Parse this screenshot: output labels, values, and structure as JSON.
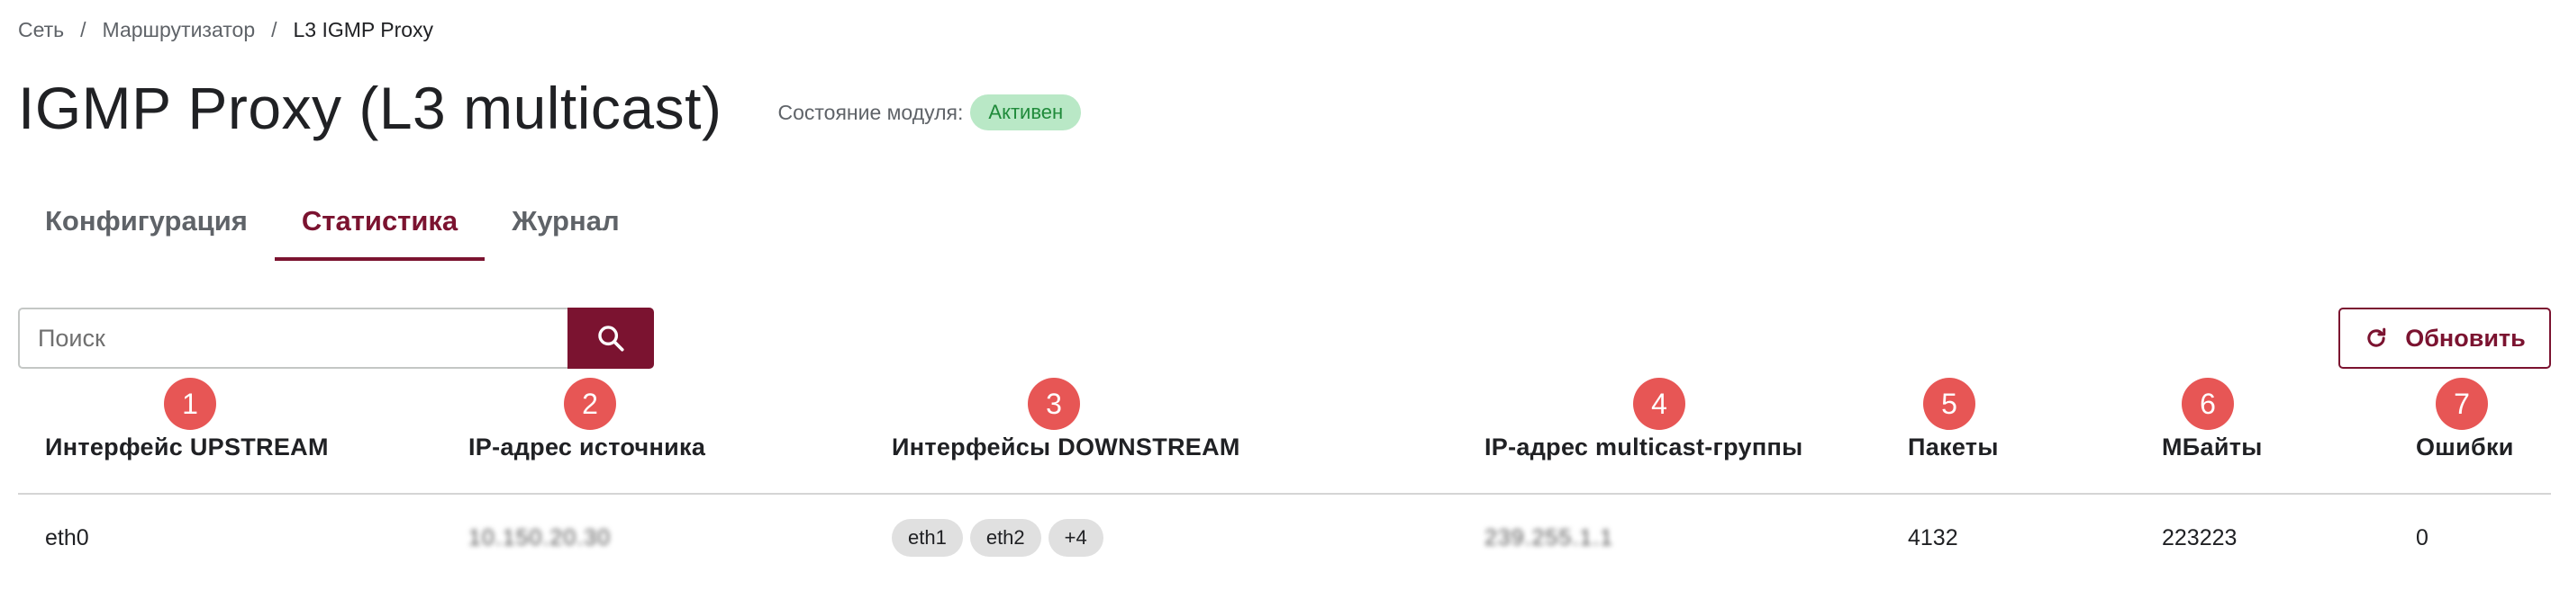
{
  "breadcrumb": {
    "items": [
      "Сеть",
      "Маршрутизатор",
      "L3 IGMP Proxy"
    ],
    "separator": "/"
  },
  "page": {
    "title": "IGMP Proxy (L3 multicast)",
    "module_state_label": "Состояние модуля:",
    "module_state_value": "Активен"
  },
  "tabs": [
    {
      "label": "Конфигурация",
      "active": false
    },
    {
      "label": "Статистика",
      "active": true
    },
    {
      "label": "Журнал",
      "active": false
    }
  ],
  "search": {
    "placeholder": "Поиск",
    "value": "",
    "icon": "search-icon"
  },
  "refresh": {
    "label": "Обновить",
    "icon": "refresh-icon"
  },
  "table": {
    "columns": [
      {
        "marker": "1",
        "label": "Интерфейс UPSTREAM"
      },
      {
        "marker": "2",
        "label": "IP-адрес источника"
      },
      {
        "marker": "3",
        "label": "Интерфейсы DOWNSTREAM"
      },
      {
        "marker": "4",
        "label": "IP-адрес multicast-группы"
      },
      {
        "marker": "5",
        "label": "Пакеты"
      },
      {
        "marker": "6",
        "label": "МБайты"
      },
      {
        "marker": "7",
        "label": "Ошибки"
      }
    ],
    "rows": [
      {
        "upstream": "eth0",
        "source_ip": "10.150.20.30",
        "downstream": [
          "eth1",
          "eth2",
          "+4"
        ],
        "group_ip": "239.255.1.1",
        "packets": "4132",
        "mbytes": "223223",
        "errors": "0"
      }
    ]
  },
  "colors": {
    "accent": "#7b1330",
    "marker": "#e75655",
    "status_bg": "#b9e8c6",
    "status_text": "#1f8a3a"
  }
}
